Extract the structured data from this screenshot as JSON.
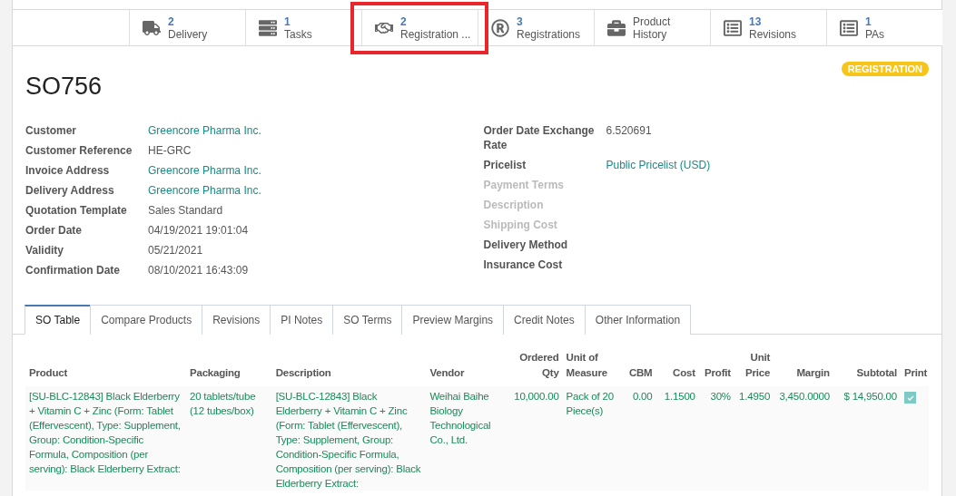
{
  "smart_buttons": [
    {
      "kind": "truck",
      "count": "2",
      "label": "Delivery",
      "highlighted": false
    },
    {
      "kind": "tasks",
      "count": "1",
      "label": "Tasks",
      "highlighted": false
    },
    {
      "kind": "handshake",
      "count": "2",
      "label": "Registration ...",
      "highlighted": true
    },
    {
      "kind": "registered",
      "count": "3",
      "label": "Registrations",
      "highlighted": false
    },
    {
      "kind": "briefcase",
      "title": "Product",
      "label": "History",
      "highlighted": false
    },
    {
      "kind": "list",
      "count": "13",
      "label": "Revisions",
      "highlighted": false
    },
    {
      "kind": "list",
      "count": "1",
      "label": "PAs",
      "highlighted": false
    }
  ],
  "status_badge": "REGISTRATION",
  "title": "SO756",
  "left_fields": [
    {
      "label": "Customer",
      "value": "Greencore Pharma Inc.",
      "kind": "link",
      "empty": false
    },
    {
      "label": "Customer Reference",
      "value": "HE-GRC",
      "kind": "plain",
      "empty": false
    },
    {
      "label": "Invoice Address",
      "value": "Greencore Pharma Inc.",
      "kind": "link",
      "empty": false
    },
    {
      "label": "Delivery Address",
      "value": "Greencore Pharma Inc.",
      "kind": "link",
      "empty": false
    },
    {
      "label": "Quotation Template",
      "value": "Sales Standard",
      "kind": "plain",
      "empty": false
    },
    {
      "label": "Order Date",
      "value": "04/19/2021 19:01:04",
      "kind": "plain",
      "empty": false
    },
    {
      "label": "Validity",
      "value": "05/21/2021",
      "kind": "plain",
      "empty": false
    },
    {
      "label": "Confirmation Date",
      "value": "08/10/2021 16:43:09",
      "kind": "plain",
      "empty": false
    }
  ],
  "right_fields": [
    {
      "label": "Order Date Exchange Rate",
      "value": "6.520691",
      "kind": "plain",
      "empty": false
    },
    {
      "label": "Pricelist",
      "value": "Public Pricelist (USD)",
      "kind": "link",
      "empty": false
    },
    {
      "label": "Payment Terms",
      "empty": true
    },
    {
      "label": "Description",
      "empty": true
    },
    {
      "label": "Shipping Cost",
      "empty": true
    },
    {
      "label": "Delivery Method",
      "empty": false
    },
    {
      "label": "Insurance Cost",
      "empty": false
    }
  ],
  "tabs": [
    {
      "label": "SO Table",
      "selected": true
    },
    {
      "label": "Compare Products",
      "selected": false
    },
    {
      "label": "Revisions",
      "selected": false
    },
    {
      "label": "PI Notes",
      "selected": false
    },
    {
      "label": "SO Terms",
      "selected": false
    },
    {
      "label": "Preview Margins",
      "selected": false
    },
    {
      "label": "Credit Notes",
      "selected": false
    },
    {
      "label": "Other Information",
      "selected": false
    }
  ],
  "table": {
    "columns": [
      "Product",
      "Packaging",
      "Description",
      "Vendor",
      "Ordered Qty",
      "Unit of Measure",
      "CBM",
      "Cost",
      "Profit",
      "Unit Price",
      "Margin",
      "Subtotal",
      "Print"
    ],
    "rows": [
      {
        "cells": [
          "[SU-BLC-12843] Black Elderberry + Vitamin C + Zinc (Form: Tablet (Effervescent), Type: Supplement, Group: Condition-Specific Formula, Composition (per serving): Black Elderberry Extract:",
          "20 tablets/tube (12 tubes/box)",
          "[SU-BLC-12843] Black Elderberry + Vitamin C + Zinc (Form: Tablet (Effervescent), Type: Supplement, Group: Condition-Specific Formula, Composition (per serving): Black Elderberry Extract:",
          "Weihai Baihe Biology Technological Co., Ltd.",
          "10,000.00",
          "Pack of 20 Piece(s)",
          "0.00",
          "1.1500",
          "30%",
          "1.4950",
          "3,450.0000",
          "$ 14,950.00"
        ],
        "print": true
      }
    ]
  }
}
